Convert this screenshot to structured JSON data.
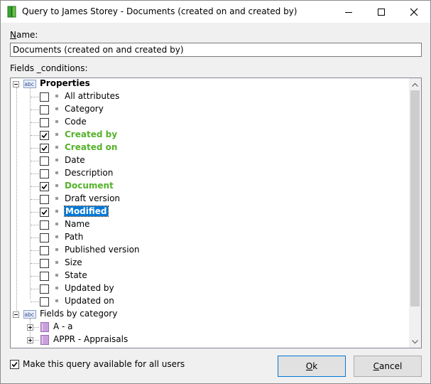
{
  "window": {
    "title": "Query to James Storey - Documents (created on and created by)"
  },
  "form": {
    "name_label_first": "N",
    "name_label_rest": "ame:",
    "name_value": "Documents (created on and created by)",
    "fields_label": "Fields _conditions:"
  },
  "tree": {
    "root_label": "Properties",
    "items": [
      {
        "label": "All attributes",
        "checked": false,
        "style": "normal"
      },
      {
        "label": "Category",
        "checked": false,
        "style": "normal"
      },
      {
        "label": "Code",
        "checked": false,
        "style": "normal"
      },
      {
        "label": "Created by",
        "checked": true,
        "style": "green"
      },
      {
        "label": "Created on",
        "checked": true,
        "style": "green"
      },
      {
        "label": "Date",
        "checked": false,
        "style": "normal"
      },
      {
        "label": "Description",
        "checked": false,
        "style": "normal"
      },
      {
        "label": "Document",
        "checked": true,
        "style": "green"
      },
      {
        "label": "Draft version",
        "checked": false,
        "style": "normal"
      },
      {
        "label": "Modified",
        "checked": true,
        "style": "selected"
      },
      {
        "label": "Name",
        "checked": false,
        "style": "normal"
      },
      {
        "label": "Path",
        "checked": false,
        "style": "normal"
      },
      {
        "label": "Published version",
        "checked": false,
        "style": "normal"
      },
      {
        "label": "Size",
        "checked": false,
        "style": "normal"
      },
      {
        "label": "State",
        "checked": false,
        "style": "normal"
      },
      {
        "label": "Updated by",
        "checked": false,
        "style": "normal"
      },
      {
        "label": "Updated on",
        "checked": false,
        "style": "normal"
      }
    ],
    "category_root_label": "Fields by category",
    "categories": [
      {
        "label": "A - a"
      },
      {
        "label": "APPR -  Appraisals"
      }
    ]
  },
  "footer": {
    "share_label": "Make this query available for all users",
    "share_checked": true,
    "ok_first": "O",
    "ok_rest": "k",
    "cancel_first": "C",
    "cancel_rest": "ancel"
  },
  "colors": {
    "checked_item": "#55b22b",
    "selection": "#0078d7",
    "folder": "#c9a0dc"
  }
}
